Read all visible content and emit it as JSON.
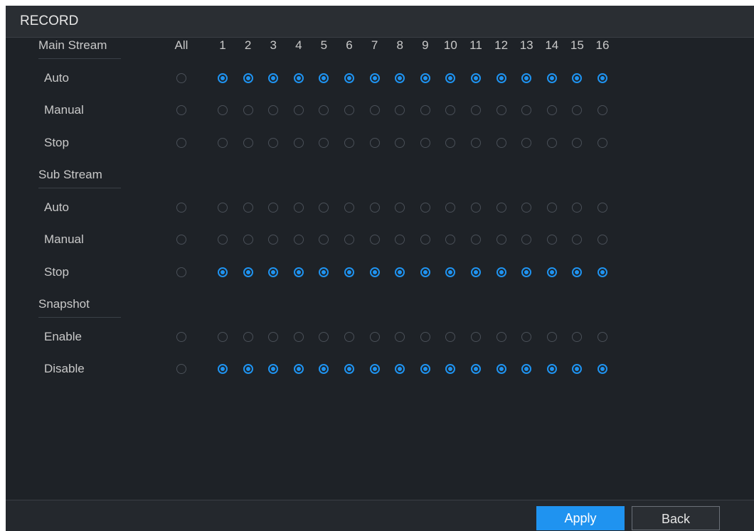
{
  "window": {
    "title": "RECORD"
  },
  "header": {
    "all_label": "All",
    "channels": [
      "1",
      "2",
      "3",
      "4",
      "5",
      "6",
      "7",
      "8",
      "9",
      "10",
      "11",
      "12",
      "13",
      "14",
      "15",
      "16"
    ]
  },
  "sections": [
    {
      "key": "main",
      "label": "Main Stream",
      "rows": [
        {
          "key": "auto",
          "label": "Auto",
          "all_selected": false,
          "selected": [
            true,
            true,
            true,
            true,
            true,
            true,
            true,
            true,
            true,
            true,
            true,
            true,
            true,
            true,
            true,
            true
          ]
        },
        {
          "key": "manual",
          "label": "Manual",
          "all_selected": false,
          "selected": [
            false,
            false,
            false,
            false,
            false,
            false,
            false,
            false,
            false,
            false,
            false,
            false,
            false,
            false,
            false,
            false
          ]
        },
        {
          "key": "stop",
          "label": "Stop",
          "all_selected": false,
          "selected": [
            false,
            false,
            false,
            false,
            false,
            false,
            false,
            false,
            false,
            false,
            false,
            false,
            false,
            false,
            false,
            false
          ]
        }
      ]
    },
    {
      "key": "sub",
      "label": "Sub Stream",
      "rows": [
        {
          "key": "auto",
          "label": "Auto",
          "all_selected": false,
          "selected": [
            false,
            false,
            false,
            false,
            false,
            false,
            false,
            false,
            false,
            false,
            false,
            false,
            false,
            false,
            false,
            false
          ]
        },
        {
          "key": "manual",
          "label": "Manual",
          "all_selected": false,
          "selected": [
            false,
            false,
            false,
            false,
            false,
            false,
            false,
            false,
            false,
            false,
            false,
            false,
            false,
            false,
            false,
            false
          ]
        },
        {
          "key": "stop",
          "label": "Stop",
          "all_selected": false,
          "selected": [
            true,
            true,
            true,
            true,
            true,
            true,
            true,
            true,
            true,
            true,
            true,
            true,
            true,
            true,
            true,
            true
          ]
        }
      ]
    },
    {
      "key": "snapshot",
      "label": "Snapshot",
      "rows": [
        {
          "key": "enable",
          "label": "Enable",
          "all_selected": false,
          "selected": [
            false,
            false,
            false,
            false,
            false,
            false,
            false,
            false,
            false,
            false,
            false,
            false,
            false,
            false,
            false,
            false
          ]
        },
        {
          "key": "disable",
          "label": "Disable",
          "all_selected": false,
          "selected": [
            true,
            true,
            true,
            true,
            true,
            true,
            true,
            true,
            true,
            true,
            true,
            true,
            true,
            true,
            true,
            true
          ]
        }
      ]
    }
  ],
  "footer": {
    "apply_label": "Apply",
    "back_label": "Back"
  },
  "colors": {
    "accent": "#1f93f0",
    "background": "#1e2227",
    "text": "#c9c9c9"
  }
}
